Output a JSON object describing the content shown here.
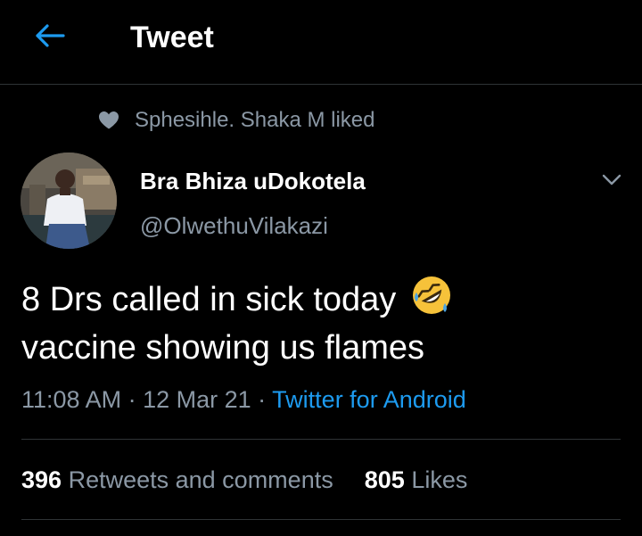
{
  "header": {
    "title": "Tweet",
    "back_icon": "arrow-left-icon",
    "accent_color": "#1d9bf0"
  },
  "social_context": {
    "icon": "heart-icon",
    "text": "Sphesihle. Shaka M liked"
  },
  "author": {
    "display_name": "Bra Bhiza uDokotela",
    "handle": "@OlwethuVilakazi"
  },
  "tweet": {
    "line1": "8 Drs called in sick today",
    "line1_emoji": "rolling-on-the-floor-laughing-emoji",
    "line2": "vaccine showing us flames"
  },
  "meta": {
    "time": "11:08 AM",
    "separator1": " · ",
    "date": "12 Mar 21",
    "separator2": " · ",
    "source": "Twitter for Android"
  },
  "stats": {
    "retweets_count": "396",
    "retweets_label": "Retweets and comments",
    "likes_count": "805",
    "likes_label": "Likes"
  },
  "colors": {
    "background": "#000000",
    "text_primary": "#ffffff",
    "text_secondary": "#8b98a5",
    "link": "#1d9bf0",
    "divider": "#2f3336"
  }
}
